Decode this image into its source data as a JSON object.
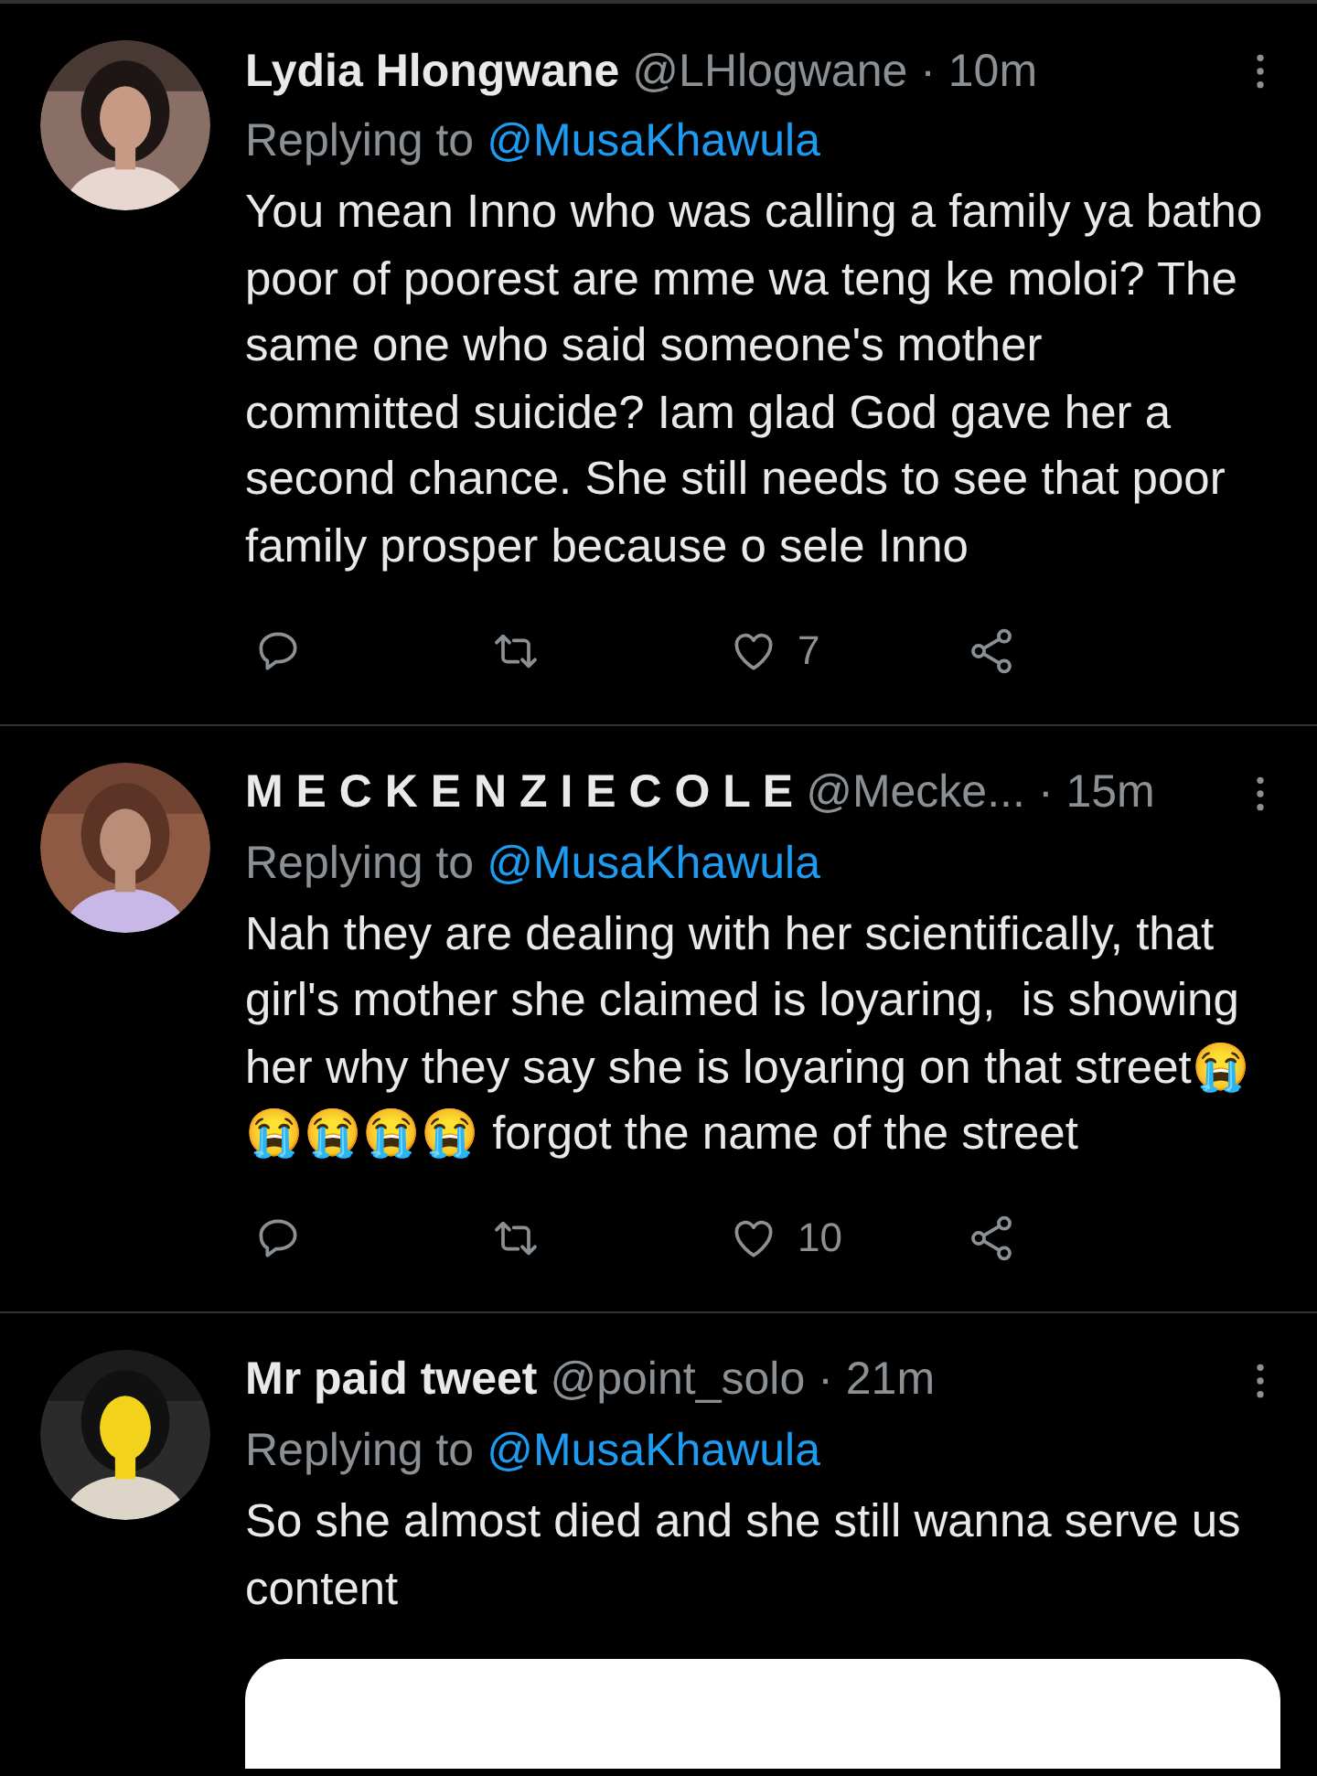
{
  "tweets": [
    {
      "name": "Lydia Hlongwane",
      "handle": "@LHlogwane",
      "time": "· 10m",
      "replying_label": "Replying to",
      "replying_to": "@MusaKhawula",
      "text": "You mean Inno who was calling a family ya batho poor of poorest are mme wa teng ke moloi? The same one who said someone's mother committed suicide? Iam glad God gave her a second chance. She still needs to see that poor family prosper because o sele Inno",
      "actions": [
        {
          "kind": "reply"
        },
        {
          "kind": "retweet"
        },
        {
          "kind": "like",
          "count": "7"
        },
        {
          "kind": "share"
        }
      ]
    },
    {
      "name": "M E C K E N Z I E C O L E",
      "handle": "@Mecke...",
      "time": "· 15m",
      "replying_label": "Replying to",
      "replying_to": "@MusaKhawula",
      "text": "Nah they are dealing with her scientifically, that girl's mother she claimed is loyaring,  is showing her why they say she is loyaring on that street😭😭😭😭😭 forgot the name of the street",
      "actions": [
        {
          "kind": "reply"
        },
        {
          "kind": "retweet"
        },
        {
          "kind": "like",
          "count": "10"
        },
        {
          "kind": "share"
        }
      ]
    },
    {
      "name": "Mr paid tweet",
      "handle": "@point_solo",
      "time": "· 21m",
      "replying_label": "Replying to",
      "replying_to": "@MusaKhawula",
      "text": "So she almost died and she still wanna serve us content",
      "media": {
        "kind": "preview"
      }
    }
  ]
}
